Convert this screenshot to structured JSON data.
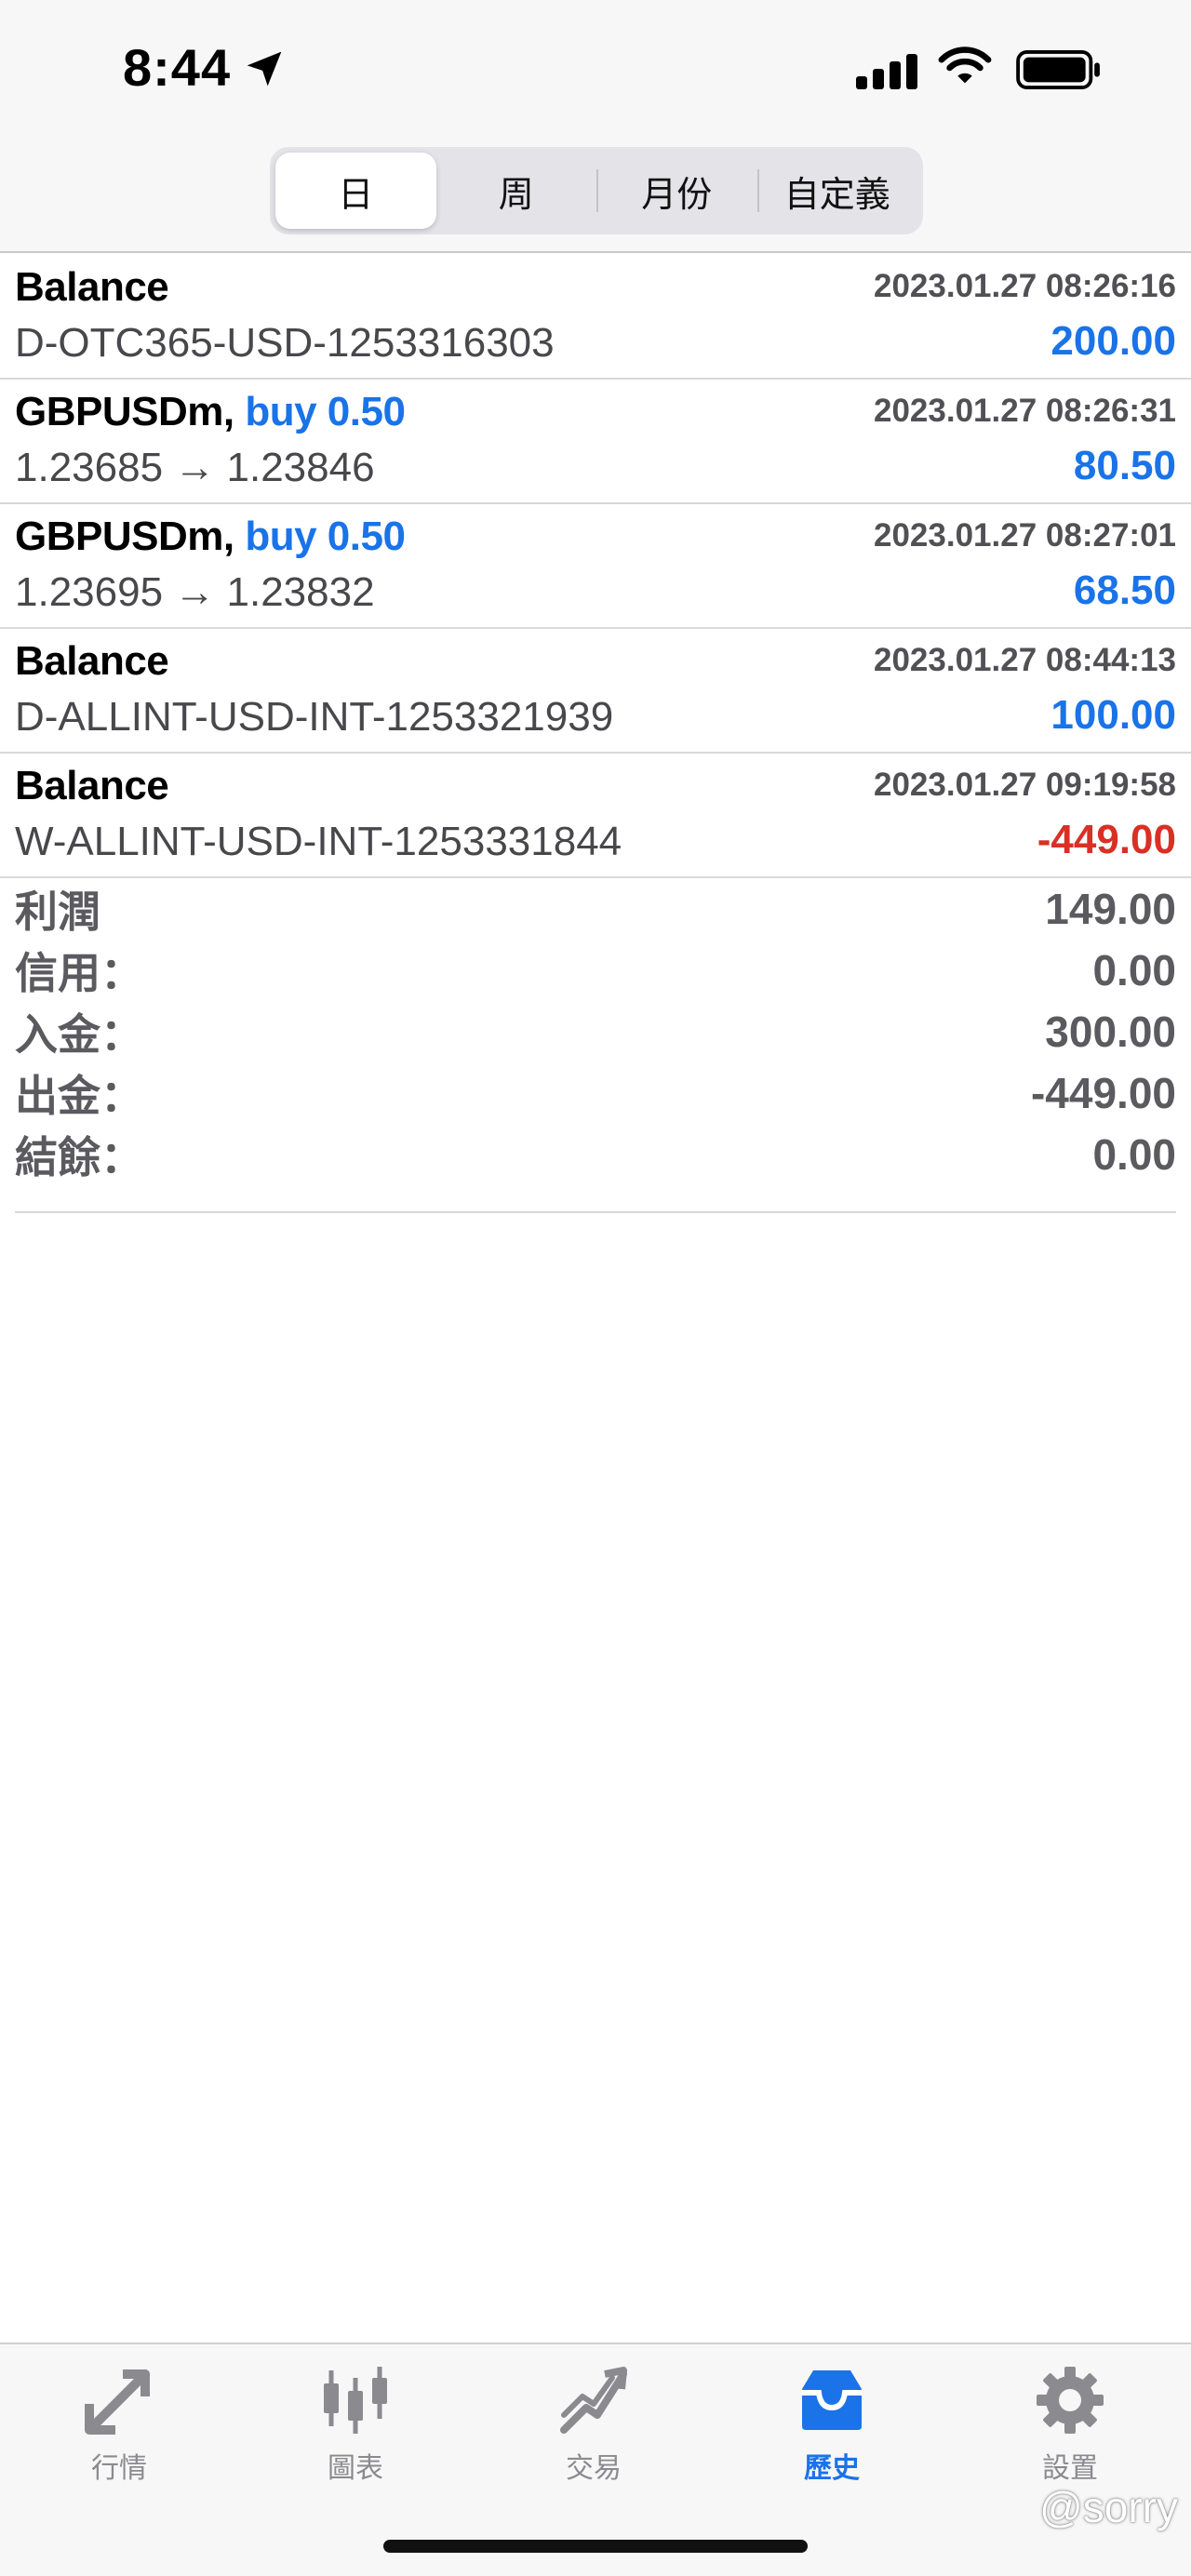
{
  "status": {
    "time": "8:44"
  },
  "segments": [
    {
      "label": "日",
      "active": true
    },
    {
      "label": "周",
      "active": false
    },
    {
      "label": "月份",
      "active": false
    },
    {
      "label": "自定義",
      "active": false
    }
  ],
  "history": [
    {
      "title": "Balance",
      "qty": "",
      "time": "2023.01.27 08:26:16",
      "detail": "D-OTC365-USD-1253316303",
      "amount": "200.00"
    },
    {
      "title": "GBPUSDm,",
      "qty": "buy 0.50",
      "time": "2023.01.27 08:26:31",
      "detail": "1.23685 → 1.23846",
      "amount": "80.50"
    },
    {
      "title": "GBPUSDm,",
      "qty": "buy 0.50",
      "time": "2023.01.27 08:27:01",
      "detail": "1.23695 → 1.23832",
      "amount": "68.50"
    },
    {
      "title": "Balance",
      "qty": "",
      "time": "2023.01.27 08:44:13",
      "detail": "D-ALLINT-USD-INT-1253321939",
      "amount": "100.00"
    },
    {
      "title": "Balance",
      "qty": "",
      "time": "2023.01.27 09:19:58",
      "detail": "W-ALLINT-USD-INT-1253331844",
      "amount": "-449.00"
    }
  ],
  "summary": [
    {
      "label": "利潤",
      "value": "149.00"
    },
    {
      "label": "信用：",
      "value": "0.00"
    },
    {
      "label": "入金：",
      "value": "300.00"
    },
    {
      "label": "出金：",
      "value": "-449.00"
    },
    {
      "label": "結餘：",
      "value": "0.00"
    }
  ],
  "tabs": [
    {
      "label": "行情",
      "icon": "quotes-arrows-icon"
    },
    {
      "label": "圖表",
      "icon": "candlestick-chart-icon"
    },
    {
      "label": "交易",
      "icon": "trade-trend-icon"
    },
    {
      "label": "歷史",
      "icon": "history-inbox-icon",
      "active": true
    },
    {
      "label": "設置",
      "icon": "gear-icon"
    }
  ],
  "watermark": "@sorry",
  "colors": {
    "accent": "#1a73e8",
    "negative": "#d93025",
    "inactive": "#8a8a8f"
  }
}
